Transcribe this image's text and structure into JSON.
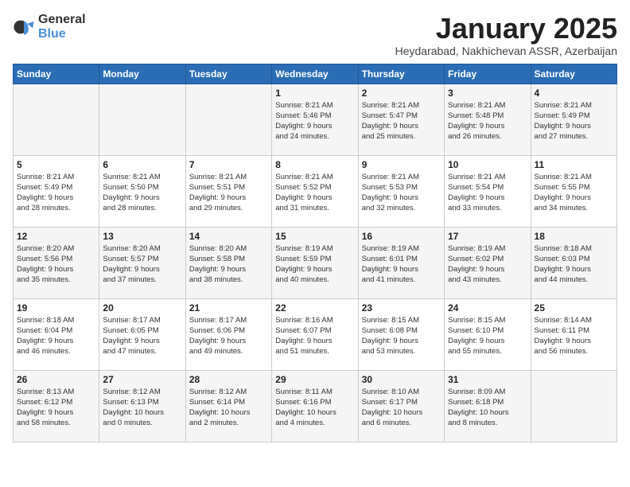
{
  "header": {
    "logo_general": "General",
    "logo_blue": "Blue",
    "month_title": "January 2025",
    "location": "Heydarabad, Nakhichevan ASSR, Azerbaijan"
  },
  "days_of_week": [
    "Sunday",
    "Monday",
    "Tuesday",
    "Wednesday",
    "Thursday",
    "Friday",
    "Saturday"
  ],
  "weeks": [
    [
      {
        "day": "",
        "info": ""
      },
      {
        "day": "",
        "info": ""
      },
      {
        "day": "",
        "info": ""
      },
      {
        "day": "1",
        "info": "Sunrise: 8:21 AM\nSunset: 5:46 PM\nDaylight: 9 hours\nand 24 minutes."
      },
      {
        "day": "2",
        "info": "Sunrise: 8:21 AM\nSunset: 5:47 PM\nDaylight: 9 hours\nand 25 minutes."
      },
      {
        "day": "3",
        "info": "Sunrise: 8:21 AM\nSunset: 5:48 PM\nDaylight: 9 hours\nand 26 minutes."
      },
      {
        "day": "4",
        "info": "Sunrise: 8:21 AM\nSunset: 5:49 PM\nDaylight: 9 hours\nand 27 minutes."
      }
    ],
    [
      {
        "day": "5",
        "info": "Sunrise: 8:21 AM\nSunset: 5:49 PM\nDaylight: 9 hours\nand 28 minutes."
      },
      {
        "day": "6",
        "info": "Sunrise: 8:21 AM\nSunset: 5:50 PM\nDaylight: 9 hours\nand 28 minutes."
      },
      {
        "day": "7",
        "info": "Sunrise: 8:21 AM\nSunset: 5:51 PM\nDaylight: 9 hours\nand 29 minutes."
      },
      {
        "day": "8",
        "info": "Sunrise: 8:21 AM\nSunset: 5:52 PM\nDaylight: 9 hours\nand 31 minutes."
      },
      {
        "day": "9",
        "info": "Sunrise: 8:21 AM\nSunset: 5:53 PM\nDaylight: 9 hours\nand 32 minutes."
      },
      {
        "day": "10",
        "info": "Sunrise: 8:21 AM\nSunset: 5:54 PM\nDaylight: 9 hours\nand 33 minutes."
      },
      {
        "day": "11",
        "info": "Sunrise: 8:21 AM\nSunset: 5:55 PM\nDaylight: 9 hours\nand 34 minutes."
      }
    ],
    [
      {
        "day": "12",
        "info": "Sunrise: 8:20 AM\nSunset: 5:56 PM\nDaylight: 9 hours\nand 35 minutes."
      },
      {
        "day": "13",
        "info": "Sunrise: 8:20 AM\nSunset: 5:57 PM\nDaylight: 9 hours\nand 37 minutes."
      },
      {
        "day": "14",
        "info": "Sunrise: 8:20 AM\nSunset: 5:58 PM\nDaylight: 9 hours\nand 38 minutes."
      },
      {
        "day": "15",
        "info": "Sunrise: 8:19 AM\nSunset: 5:59 PM\nDaylight: 9 hours\nand 40 minutes."
      },
      {
        "day": "16",
        "info": "Sunrise: 8:19 AM\nSunset: 6:01 PM\nDaylight: 9 hours\nand 41 minutes."
      },
      {
        "day": "17",
        "info": "Sunrise: 8:19 AM\nSunset: 6:02 PM\nDaylight: 9 hours\nand 43 minutes."
      },
      {
        "day": "18",
        "info": "Sunrise: 8:18 AM\nSunset: 6:03 PM\nDaylight: 9 hours\nand 44 minutes."
      }
    ],
    [
      {
        "day": "19",
        "info": "Sunrise: 8:18 AM\nSunset: 6:04 PM\nDaylight: 9 hours\nand 46 minutes."
      },
      {
        "day": "20",
        "info": "Sunrise: 8:17 AM\nSunset: 6:05 PM\nDaylight: 9 hours\nand 47 minutes."
      },
      {
        "day": "21",
        "info": "Sunrise: 8:17 AM\nSunset: 6:06 PM\nDaylight: 9 hours\nand 49 minutes."
      },
      {
        "day": "22",
        "info": "Sunrise: 8:16 AM\nSunset: 6:07 PM\nDaylight: 9 hours\nand 51 minutes."
      },
      {
        "day": "23",
        "info": "Sunrise: 8:15 AM\nSunset: 6:08 PM\nDaylight: 9 hours\nand 53 minutes."
      },
      {
        "day": "24",
        "info": "Sunrise: 8:15 AM\nSunset: 6:10 PM\nDaylight: 9 hours\nand 55 minutes."
      },
      {
        "day": "25",
        "info": "Sunrise: 8:14 AM\nSunset: 6:11 PM\nDaylight: 9 hours\nand 56 minutes."
      }
    ],
    [
      {
        "day": "26",
        "info": "Sunrise: 8:13 AM\nSunset: 6:12 PM\nDaylight: 9 hours\nand 58 minutes."
      },
      {
        "day": "27",
        "info": "Sunrise: 8:12 AM\nSunset: 6:13 PM\nDaylight: 10 hours\nand 0 minutes."
      },
      {
        "day": "28",
        "info": "Sunrise: 8:12 AM\nSunset: 6:14 PM\nDaylight: 10 hours\nand 2 minutes."
      },
      {
        "day": "29",
        "info": "Sunrise: 8:11 AM\nSunset: 6:16 PM\nDaylight: 10 hours\nand 4 minutes."
      },
      {
        "day": "30",
        "info": "Sunrise: 8:10 AM\nSunset: 6:17 PM\nDaylight: 10 hours\nand 6 minutes."
      },
      {
        "day": "31",
        "info": "Sunrise: 8:09 AM\nSunset: 6:18 PM\nDaylight: 10 hours\nand 8 minutes."
      },
      {
        "day": "",
        "info": ""
      }
    ]
  ]
}
